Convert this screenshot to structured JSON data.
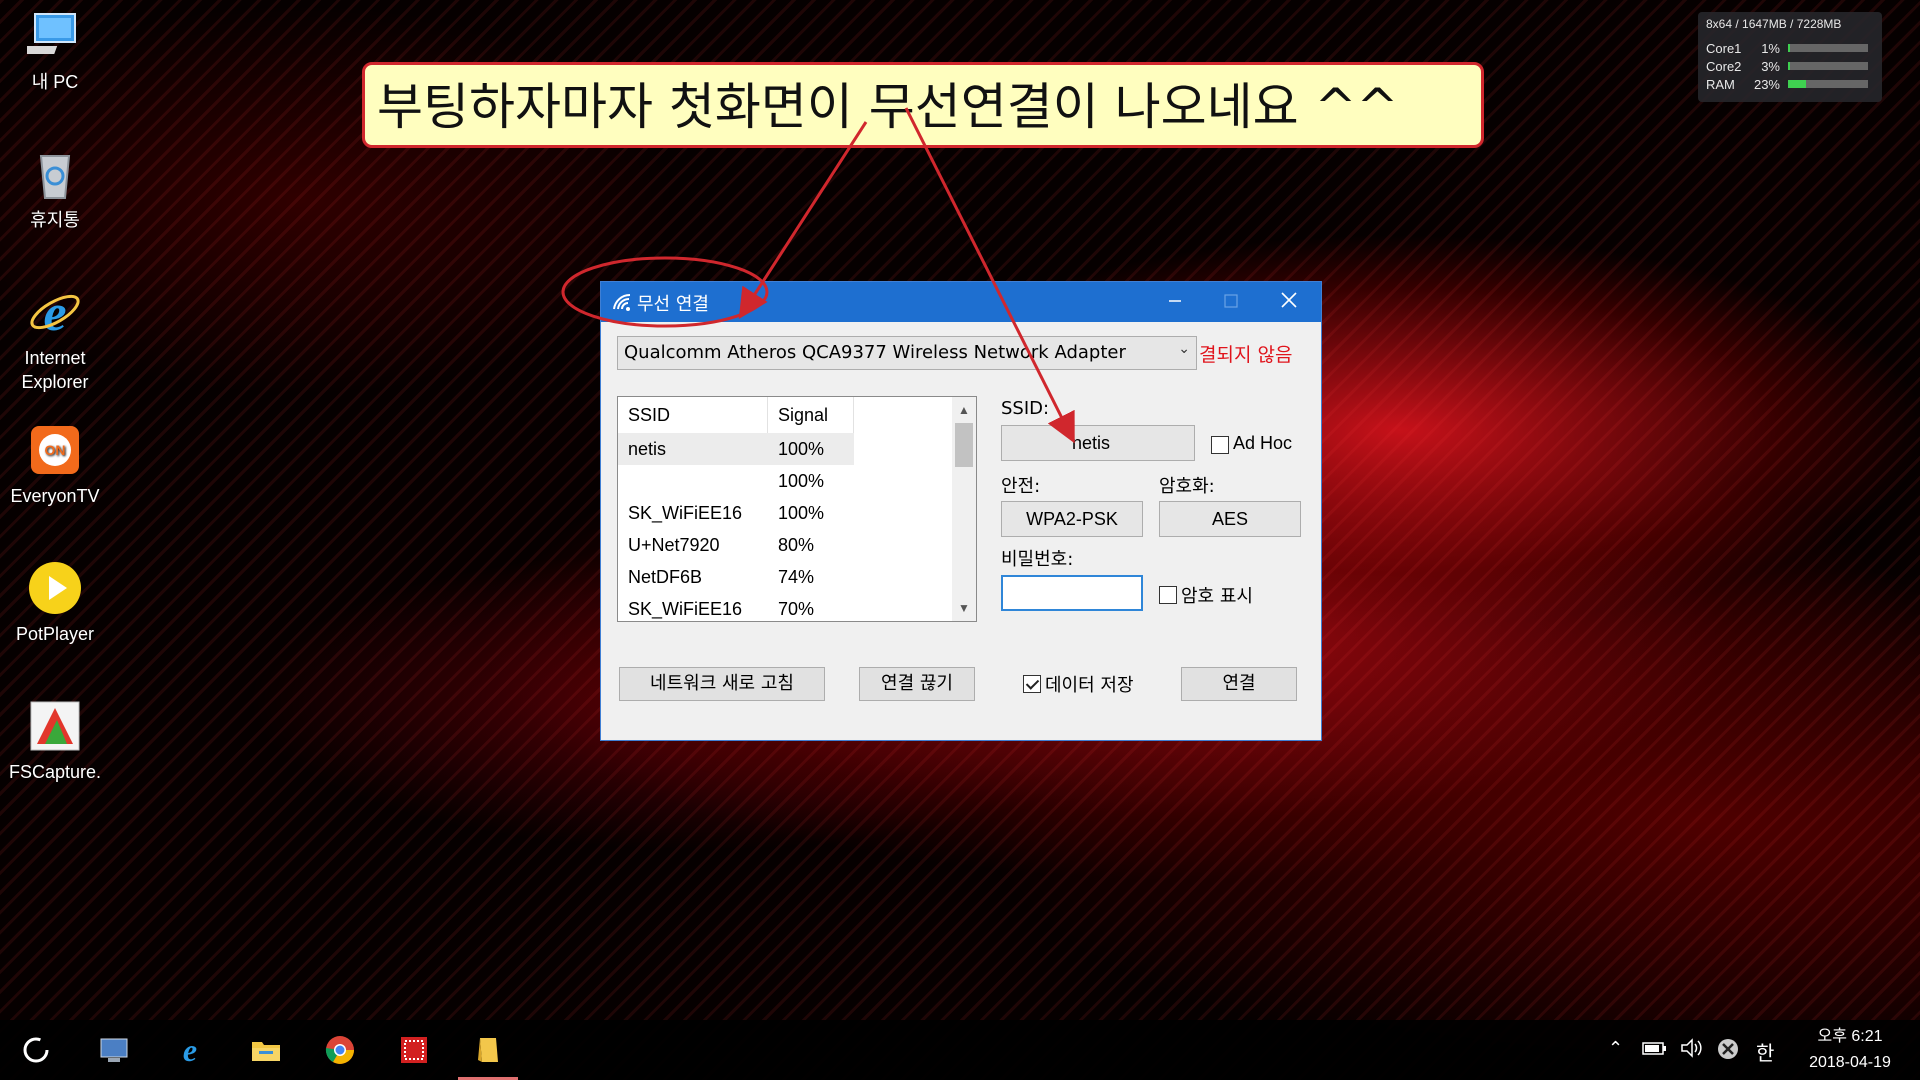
{
  "desktop": {
    "icons": [
      {
        "label": "내 PC",
        "icon": "computer-icon"
      },
      {
        "label": "휴지통",
        "icon": "recycle-bin-icon"
      },
      {
        "label": "Internet Explorer",
        "icon": "internet-explorer-icon"
      },
      {
        "label": "EveryonTV",
        "icon": "everyontv-icon"
      },
      {
        "label": "PotPlayer",
        "icon": "potplayer-icon"
      },
      {
        "label": "FSCapture.",
        "icon": "fscapture-icon"
      }
    ]
  },
  "meter": {
    "header": "8x64 / 1647MB / 7228MB",
    "rows": [
      {
        "name": "Core1",
        "percent": "1%",
        "value": 0.01
      },
      {
        "name": "Core2",
        "percent": "3%",
        "value": 0.03
      },
      {
        "name": "RAM",
        "percent": "23%",
        "value": 0.23
      }
    ]
  },
  "annotation": {
    "text": "부팅하자마자 첫화면이 무선연결이 나오네요 ^^",
    "color": "#d0272d"
  },
  "dialog": {
    "title": "무선 연결",
    "title_icon": "wifi-icon",
    "adapter": "Qualcomm Atheros QCA9377 Wireless Network Adapter",
    "status": "결되지 않음",
    "list": {
      "col_ssid": "SSID",
      "col_signal": "Signal",
      "rows": [
        {
          "ssid": "netis",
          "signal": "100%"
        },
        {
          "ssid": "",
          "signal": "100%"
        },
        {
          "ssid": "SK_WiFiEE16",
          "signal": "100%"
        },
        {
          "ssid": "U+Net7920",
          "signal": "80%"
        },
        {
          "ssid": "NetDF6B",
          "signal": "74%"
        },
        {
          "ssid": "SK_WiFiEE16",
          "signal": "70%"
        }
      ]
    },
    "ssid_label": "SSID:",
    "ssid_value": "netis",
    "adhoc_label": "Ad Hoc",
    "security_label": "안전:",
    "security_value": "WPA2-PSK",
    "encryption_label": "암호화:",
    "encryption_value": "AES",
    "password_label": "비밀번호:",
    "password_value": "",
    "show_password_label": "암호 표시",
    "refresh_button": "네트워크 새로 고침",
    "disconnect_button": "연결 끊기",
    "save_data_label": "데이터 저장",
    "save_data_checked": true,
    "connect_button": "연결"
  },
  "taskbar": {
    "apps": [
      {
        "icon": "start-icon"
      },
      {
        "icon": "monitor-app-icon"
      },
      {
        "icon": "internet-explorer-icon"
      },
      {
        "icon": "file-explorer-icon"
      },
      {
        "icon": "chrome-icon"
      },
      {
        "icon": "red-app-icon"
      },
      {
        "icon": "folder-notes-icon"
      }
    ],
    "ime": "한",
    "clock_time": "오후 6:21",
    "clock_date": "2018-04-19"
  }
}
